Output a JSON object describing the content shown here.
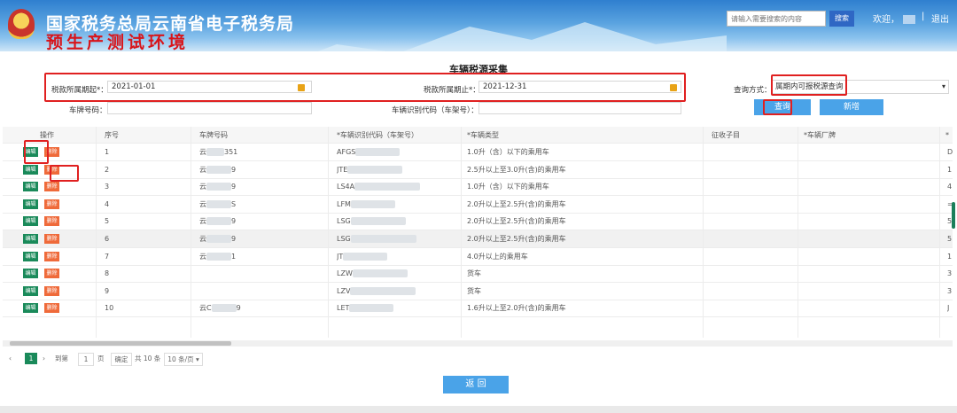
{
  "header": {
    "title": "国家税务总局云南省电子税务局",
    "env_label": "预生产测试环境",
    "search_placeholder": "请输入需要搜索的内容",
    "search_button": "搜索",
    "welcome": "欢迎，",
    "separator": "|",
    "logout": "退出"
  },
  "page_title": "车辆税源采集",
  "filters": {
    "period_start_label": "税款所属期起*：",
    "period_start_value": "2021-01-01",
    "period_end_label": "税款所属期止*：",
    "period_end_value": "2021-12-31",
    "plate_label": "车牌号码：",
    "vin_label": "车辆识别代码（车架号）：",
    "query_mode_label": "查询方式：",
    "query_mode_value": "属期内可报税源查询",
    "query_button": "查询",
    "add_button": "新增"
  },
  "table": {
    "headers": [
      "操作",
      "序号",
      "车牌号码",
      "*车辆识别代码（车架号）",
      "*车辆类型",
      "征收子目",
      "*车辆厂牌",
      "*"
    ],
    "edit_label": "编辑",
    "delete_label": "删除",
    "rows": [
      {
        "seq": "1",
        "plate": "云",
        "plate_suffix": "351",
        "vin": "AFGS",
        "type": "1.0升（含）以下的乘用车",
        "tail": "D"
      },
      {
        "seq": "2",
        "plate": "云",
        "plate_suffix": "9",
        "vin": "JTE",
        "type": "2.5升以上至3.0升(含)的乘用车",
        "tail": "1"
      },
      {
        "seq": "3",
        "plate": "云",
        "plate_suffix": "9",
        "vin": "LS4A",
        "type": "1.0升（含）以下的乘用车",
        "tail": "4"
      },
      {
        "seq": "4",
        "plate": "云",
        "plate_suffix": "S",
        "vin": "LFM",
        "type": "2.0升以上至2.5升(含)的乘用车",
        "tail": "="
      },
      {
        "seq": "5",
        "plate": "云",
        "plate_suffix": "9",
        "vin": "LSG",
        "type": "2.0升以上至2.5升(含)的乘用车",
        "tail": "5"
      },
      {
        "seq": "6",
        "plate": "云",
        "plate_suffix": "9",
        "vin": "LSG",
        "type": "2.0升以上至2.5升(含)的乘用车",
        "tail": "5"
      },
      {
        "seq": "7",
        "plate": "云",
        "plate_suffix": "1",
        "vin": "JT",
        "type": "4.0升以上的乘用车",
        "tail": "1"
      },
      {
        "seq": "8",
        "plate": "",
        "plate_suffix": "",
        "vin": "LZW",
        "type": "货车",
        "tail": "3"
      },
      {
        "seq": "9",
        "plate": "",
        "plate_suffix": "",
        "vin": "LZV",
        "type": "货车",
        "tail": "3"
      },
      {
        "seq": "10",
        "plate": "云C",
        "plate_suffix": "9",
        "vin": "LET",
        "type": "1.6升以上至2.0升(含)的乘用车",
        "tail": "J"
      }
    ]
  },
  "pager": {
    "current": "1",
    "goto_label": "到第",
    "page_input": "1",
    "page_unit": "页",
    "confirm": "确定",
    "total": "共 10 条",
    "page_size": "10 条/页"
  },
  "back_button": "返 回",
  "colors": {
    "header_blue": "#2f7fcf",
    "highlight_red": "#e02020",
    "edit_green": "#1a8a5a",
    "delete_orange": "#ef6a3a",
    "button_blue": "#4aa3e8"
  }
}
